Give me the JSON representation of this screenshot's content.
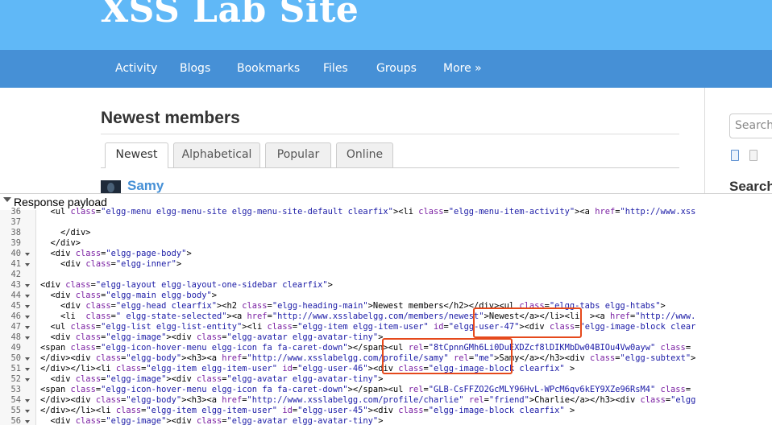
{
  "site": {
    "title": "XSS Lab Site",
    "nav": [
      "Activity",
      "Blogs",
      "Bookmarks",
      "Files",
      "Groups",
      "More »"
    ]
  },
  "main": {
    "heading": "Newest members",
    "tabs": [
      "Newest",
      "Alphabetical",
      "Popular",
      "Online"
    ],
    "active_tab": "Newest",
    "member": {
      "name": "Samy"
    }
  },
  "sidebar": {
    "search_placeholder": "Search",
    "heading": "Search"
  },
  "devtools": {
    "panel_title": "Response payload",
    "lines": [
      {
        "n": "36",
        "fold": false,
        "segs": [
          [
            "  <ul ",
            "t"
          ],
          [
            "class",
            "a"
          ],
          [
            "=",
            "t"
          ],
          [
            "\"elgg-menu elgg-menu-site elgg-menu-site-default clearfix\"",
            "v"
          ],
          [
            "><li ",
            "t"
          ],
          [
            "class",
            "a"
          ],
          [
            "=",
            "t"
          ],
          [
            "\"elgg-menu-item-activity\"",
            "v"
          ],
          [
            "><a ",
            "t"
          ],
          [
            "href",
            "a"
          ],
          [
            "=",
            "t"
          ],
          [
            "\"http://www.xss",
            "v"
          ]
        ]
      },
      {
        "n": "37",
        "fold": false,
        "segs": []
      },
      {
        "n": "38",
        "fold": false,
        "segs": [
          [
            "    </div>",
            "t"
          ]
        ]
      },
      {
        "n": "39",
        "fold": false,
        "segs": [
          [
            "  </div>",
            "t"
          ]
        ]
      },
      {
        "n": "40",
        "fold": true,
        "segs": [
          [
            "  <div ",
            "t"
          ],
          [
            "class",
            "a"
          ],
          [
            "=",
            "t"
          ],
          [
            "\"elgg-page-body\"",
            "v"
          ],
          [
            ">",
            "t"
          ]
        ]
      },
      {
        "n": "41",
        "fold": true,
        "segs": [
          [
            "    <div ",
            "t"
          ],
          [
            "class",
            "a"
          ],
          [
            "=",
            "t"
          ],
          [
            "\"elgg-inner\"",
            "v"
          ],
          [
            ">",
            "t"
          ]
        ]
      },
      {
        "n": "42",
        "fold": false,
        "segs": []
      },
      {
        "n": "43",
        "fold": true,
        "segs": [
          [
            "<div ",
            "t"
          ],
          [
            "class",
            "a"
          ],
          [
            "=",
            "t"
          ],
          [
            "\"elgg-layout elgg-layout-one-sidebar clearfix\"",
            "v"
          ],
          [
            ">",
            "t"
          ]
        ]
      },
      {
        "n": "44",
        "fold": true,
        "segs": [
          [
            "  <div ",
            "t"
          ],
          [
            "class",
            "a"
          ],
          [
            "=",
            "t"
          ],
          [
            "\"elgg-main elgg-body\"",
            "v"
          ],
          [
            ">",
            "t"
          ]
        ]
      },
      {
        "n": "45",
        "fold": true,
        "segs": [
          [
            "    <div ",
            "t"
          ],
          [
            "class",
            "a"
          ],
          [
            "=",
            "t"
          ],
          [
            "\"elgg-head clearfix\"",
            "v"
          ],
          [
            "><h2 ",
            "t"
          ],
          [
            "class",
            "a"
          ],
          [
            "=",
            "t"
          ],
          [
            "\"elgg-heading-main\"",
            "v"
          ],
          [
            ">Newest members</h2></div><ul ",
            "t"
          ],
          [
            "class",
            "a"
          ],
          [
            "=",
            "t"
          ],
          [
            "\"elgg-tabs elgg-htabs\"",
            "v"
          ],
          [
            ">",
            "t"
          ]
        ]
      },
      {
        "n": "46",
        "fold": true,
        "segs": [
          [
            "    <li  ",
            "t"
          ],
          [
            "class",
            "a"
          ],
          [
            "=",
            "t"
          ],
          [
            "\" elgg-state-selected\"",
            "v"
          ],
          [
            "><a ",
            "t"
          ],
          [
            "href",
            "a"
          ],
          [
            "=",
            "t"
          ],
          [
            "\"http://www.xsslabelgg.com/members/newest\"",
            "v"
          ],
          [
            ">Newest</a></li><li  ><a ",
            "t"
          ],
          [
            "href",
            "a"
          ],
          [
            "=",
            "t"
          ],
          [
            "\"http://www.",
            "v"
          ]
        ]
      },
      {
        "n": "47",
        "fold": true,
        "segs": [
          [
            "  <ul ",
            "t"
          ],
          [
            "class",
            "a"
          ],
          [
            "=",
            "t"
          ],
          [
            "\"elgg-list elgg-list-entity\"",
            "v"
          ],
          [
            "><li ",
            "t"
          ],
          [
            "class",
            "a"
          ],
          [
            "=",
            "t"
          ],
          [
            "\"elgg-item elgg-item-user\"",
            "v"
          ],
          [
            " ",
            "t"
          ],
          [
            "id",
            "a"
          ],
          [
            "=",
            "t"
          ],
          [
            "\"elgg-user-47\"",
            "v"
          ],
          [
            "><div ",
            "t"
          ],
          [
            "class",
            "a"
          ],
          [
            "=",
            "t"
          ],
          [
            "\"elgg-image-block clear",
            "v"
          ]
        ]
      },
      {
        "n": "48",
        "fold": true,
        "segs": [
          [
            "  <div ",
            "t"
          ],
          [
            "class",
            "a"
          ],
          [
            "=",
            "t"
          ],
          [
            "\"elgg-image\"",
            "v"
          ],
          [
            "><div ",
            "t"
          ],
          [
            "class",
            "a"
          ],
          [
            "=",
            "t"
          ],
          [
            "\"elgg-avatar elgg-avatar-tiny\"",
            "v"
          ],
          [
            ">",
            "t"
          ]
        ]
      },
      {
        "n": "49",
        "fold": false,
        "segs": [
          [
            "<span ",
            "t"
          ],
          [
            "class",
            "a"
          ],
          [
            "=",
            "t"
          ],
          [
            "\"elgg-icon-hover-menu elgg-icon fa fa-caret-down\"",
            "v"
          ],
          [
            "></span><ul ",
            "t"
          ],
          [
            "rel",
            "a"
          ],
          [
            "=",
            "t"
          ],
          [
            "\"8tCpnnGMh6Li0DuEXDZcf8lDIKMbDw04BIOu4Vw0ayw\"",
            "v"
          ],
          [
            " ",
            "t"
          ],
          [
            "class",
            "a"
          ],
          [
            "=",
            "t"
          ]
        ]
      },
      {
        "n": "50",
        "fold": true,
        "segs": [
          [
            "</div><div ",
            "t"
          ],
          [
            "class",
            "a"
          ],
          [
            "=",
            "t"
          ],
          [
            "\"elgg-body\"",
            "v"
          ],
          [
            "><h3><a ",
            "t"
          ],
          [
            "href",
            "a"
          ],
          [
            "=",
            "t"
          ],
          [
            "\"http://www.xsslabelgg.com/profile/samy\"",
            "v"
          ],
          [
            " ",
            "t"
          ],
          [
            "rel",
            "a"
          ],
          [
            "=",
            "t"
          ],
          [
            "\"me\"",
            "v"
          ],
          [
            ">Samy</a></h3><div ",
            "t"
          ],
          [
            "class",
            "a"
          ],
          [
            "=",
            "t"
          ],
          [
            "\"elgg-subtext\"",
            "v"
          ],
          [
            ">",
            "t"
          ]
        ]
      },
      {
        "n": "51",
        "fold": true,
        "segs": [
          [
            "</div></li><li ",
            "t"
          ],
          [
            "class",
            "a"
          ],
          [
            "=",
            "t"
          ],
          [
            "\"elgg-item elgg-item-user\"",
            "v"
          ],
          [
            " ",
            "t"
          ],
          [
            "id",
            "a"
          ],
          [
            "=",
            "t"
          ],
          [
            "\"elgg-user-46\"",
            "v"
          ],
          [
            "><div ",
            "t"
          ],
          [
            "class",
            "a"
          ],
          [
            "=",
            "t"
          ],
          [
            "\"elgg-image-block clearfix\"",
            "v"
          ],
          [
            " >",
            "t"
          ]
        ]
      },
      {
        "n": "52",
        "fold": true,
        "segs": [
          [
            "  <div ",
            "t"
          ],
          [
            "class",
            "a"
          ],
          [
            "=",
            "t"
          ],
          [
            "\"elgg-image\"",
            "v"
          ],
          [
            "><div ",
            "t"
          ],
          [
            "class",
            "a"
          ],
          [
            "=",
            "t"
          ],
          [
            "\"elgg-avatar elgg-avatar-tiny\"",
            "v"
          ],
          [
            ">",
            "t"
          ]
        ]
      },
      {
        "n": "53",
        "fold": false,
        "segs": [
          [
            "<span ",
            "t"
          ],
          [
            "class",
            "a"
          ],
          [
            "=",
            "t"
          ],
          [
            "\"elgg-icon-hover-menu elgg-icon fa fa-caret-down\"",
            "v"
          ],
          [
            "></span><ul ",
            "t"
          ],
          [
            "rel",
            "a"
          ],
          [
            "=",
            "t"
          ],
          [
            "\"GLB-CsFFZO2GcMLY96HvL-WPcM6qv6kEY9XZe96RsM4\"",
            "v"
          ],
          [
            " ",
            "t"
          ],
          [
            "class",
            "a"
          ],
          [
            "=",
            "t"
          ]
        ]
      },
      {
        "n": "54",
        "fold": true,
        "segs": [
          [
            "</div><div ",
            "t"
          ],
          [
            "class",
            "a"
          ],
          [
            "=",
            "t"
          ],
          [
            "\"elgg-body\"",
            "v"
          ],
          [
            "><h3><a ",
            "t"
          ],
          [
            "href",
            "a"
          ],
          [
            "=",
            "t"
          ],
          [
            "\"http://www.xsslabelgg.com/profile/charlie\"",
            "v"
          ],
          [
            " ",
            "t"
          ],
          [
            "rel",
            "a"
          ],
          [
            "=",
            "t"
          ],
          [
            "\"friend\"",
            "v"
          ],
          [
            ">Charlie</a></h3><div ",
            "t"
          ],
          [
            "class",
            "a"
          ],
          [
            "=",
            "t"
          ],
          [
            "\"elgg",
            "v"
          ]
        ]
      },
      {
        "n": "55",
        "fold": true,
        "segs": [
          [
            "</div></li><li ",
            "t"
          ],
          [
            "class",
            "a"
          ],
          [
            "=",
            "t"
          ],
          [
            "\"elgg-item elgg-item-user\"",
            "v"
          ],
          [
            " ",
            "t"
          ],
          [
            "id",
            "a"
          ],
          [
            "=",
            "t"
          ],
          [
            "\"elgg-user-45\"",
            "v"
          ],
          [
            "><div ",
            "t"
          ],
          [
            "class",
            "a"
          ],
          [
            "=",
            "t"
          ],
          [
            "\"elgg-image-block clearfix\"",
            "v"
          ],
          [
            " >",
            "t"
          ]
        ]
      },
      {
        "n": "56",
        "fold": true,
        "segs": [
          [
            "  <div ",
            "t"
          ],
          [
            "class",
            "a"
          ],
          [
            "=",
            "t"
          ],
          [
            "\"elgg-image\"",
            "v"
          ],
          [
            "><div ",
            "t"
          ],
          [
            "class",
            "a"
          ],
          [
            "=",
            "t"
          ],
          [
            "\"elgg-avatar elgg-avatar-tiny\"",
            "v"
          ],
          [
            ">",
            "t"
          ]
        ]
      }
    ]
  },
  "colors": {
    "header_bg": "#60b8f7",
    "nav_bg": "#4690d6",
    "link": "#4690d6",
    "code_tag": "#000000",
    "code_attr": "#7a1fa2",
    "code_value": "#1a1aa6",
    "annotation": "#e5491c"
  }
}
